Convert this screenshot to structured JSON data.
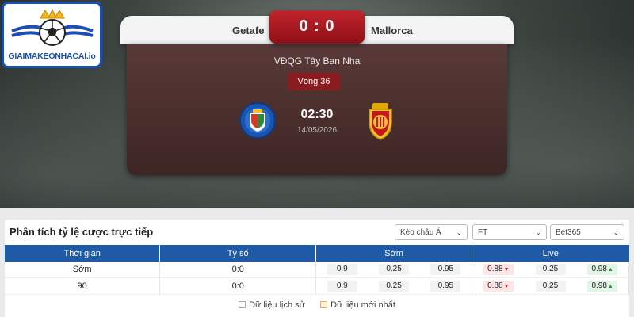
{
  "brand": {
    "logo_text": "GIAIMAKEONHACAI.io"
  },
  "match": {
    "home_team": "Getafe",
    "away_team": "Mallorca",
    "score": "0 : 0",
    "league": "VĐQG Tây Ban Nha",
    "round": "Vòng 36",
    "kickoff_time": "02:30",
    "date": "14/05/2026"
  },
  "odds_panel": {
    "title": "Phân tích tỷ lệ cược trực tiếp",
    "filters": {
      "market": "Kèo châu Á",
      "period": "FT",
      "bookmaker": "Bet365"
    },
    "columns": [
      "Thời gian",
      "Tỷ số",
      "Sớm",
      "Live"
    ],
    "rows": [
      {
        "time": "Sớm",
        "score": "0:0",
        "early": [
          "0.9",
          "0.25",
          "0.95"
        ],
        "live": [
          "0.88",
          "0.25",
          "0.98"
        ]
      },
      {
        "time": "90",
        "score": "0:0",
        "early": [
          "0.9",
          "0.25",
          "0.95"
        ],
        "live": [
          "0.88",
          "0.25",
          "0.98"
        ]
      }
    ],
    "legend": {
      "history": "Dữ liệu lịch sử",
      "latest": "Dữ liệu mới nhất"
    }
  },
  "colors": {
    "accent_blue": "#1f5aa6",
    "score_red": "#c2242b",
    "odds_down": "#d02020",
    "odds_up": "#1f9a3a"
  }
}
